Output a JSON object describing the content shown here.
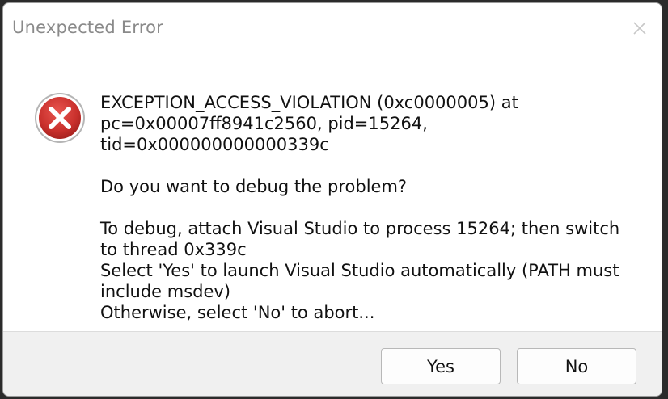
{
  "window": {
    "title": "Unexpected Error"
  },
  "icons": {
    "error": "error-x-icon",
    "close": "close-icon"
  },
  "message": {
    "line1": "EXCEPTION_ACCESS_VIOLATION (0xc0000005) at",
    "line2": "pc=0x00007ff8941c2560, pid=15264, tid=0x000000000000339c",
    "question": "Do you want to debug the problem?",
    "line3": "To debug, attach Visual Studio to process 15264; then switch",
    "line4": "to thread 0x339c",
    "line5": "Select 'Yes' to launch Visual Studio automatically (PATH must",
    "line6": "include msdev)",
    "line7": "Otherwise, select 'No' to abort..."
  },
  "buttons": {
    "yes_label": "Yes",
    "no_label": "No"
  },
  "colors": {
    "error_red": "#c9302c",
    "title_gray": "#8a8a8a",
    "footer_bg": "#f0f0f0"
  }
}
